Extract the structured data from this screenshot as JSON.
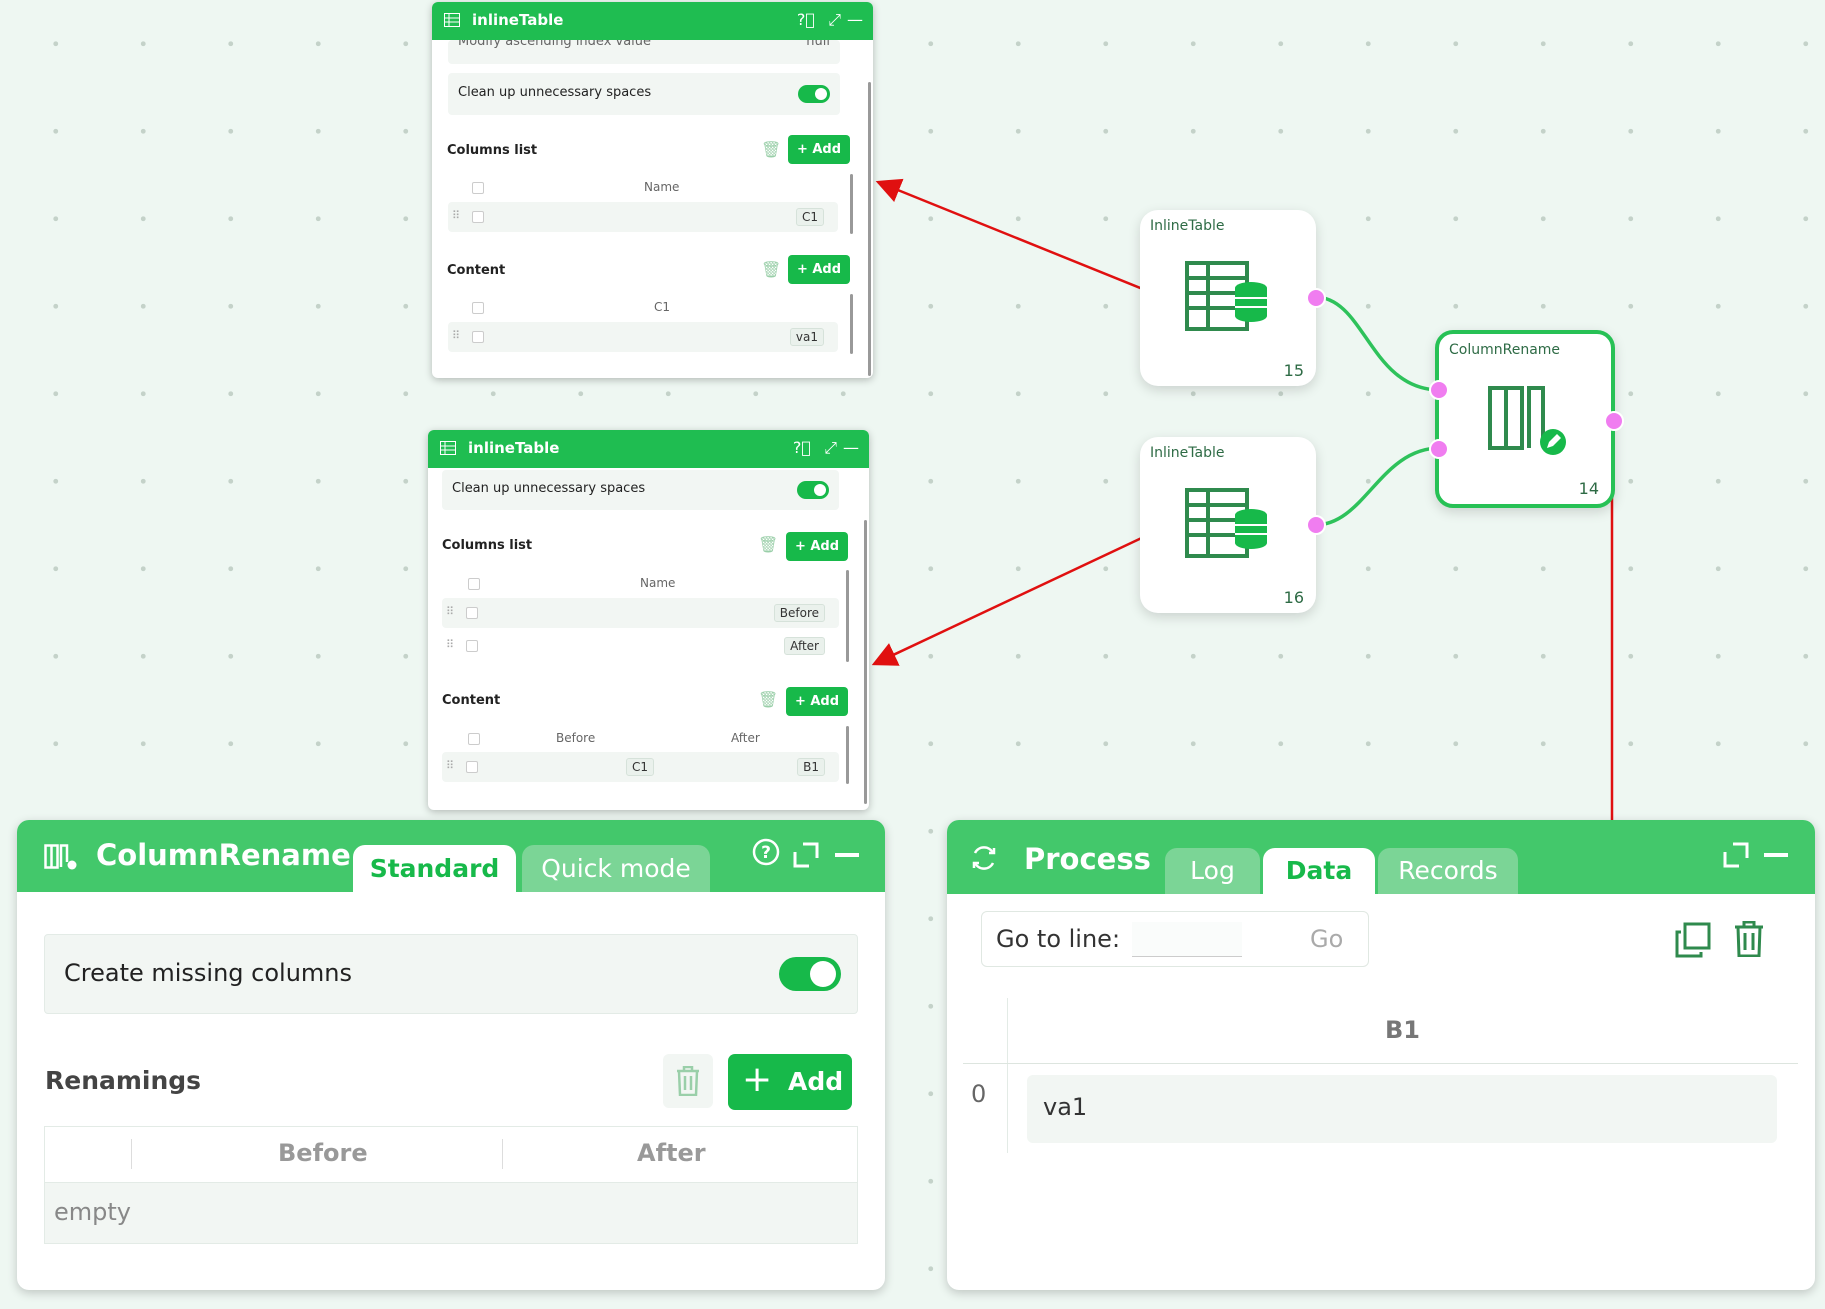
{
  "inline_table_top": {
    "title": "inlineTable",
    "clipped_row_label": "Modify ascending index value",
    "clipped_row_value": "null",
    "cleanup_label": "Clean up unnecessary spaces",
    "columns_list_label": "Columns list",
    "add_label": "Add",
    "name_header": "Name",
    "columns": [
      "C1"
    ],
    "content_label": "Content",
    "content_headers": [
      "C1"
    ],
    "content_rows": [
      [
        "va1"
      ]
    ]
  },
  "inline_table_bottom": {
    "title": "inlineTable",
    "cleanup_label": "Clean up unnecessary spaces",
    "columns_list_label": "Columns list",
    "add_label": "Add",
    "name_header": "Name",
    "columns": [
      "Before",
      "After"
    ],
    "content_label": "Content",
    "content_headers": [
      "Before",
      "After"
    ],
    "content_rows": [
      [
        "C1",
        "B1"
      ]
    ]
  },
  "nodes": {
    "inline_table_1": {
      "title": "InlineTable",
      "number": "15"
    },
    "inline_table_2": {
      "title": "InlineTable",
      "number": "16"
    },
    "column_rename": {
      "title": "ColumnRename",
      "number": "14"
    }
  },
  "column_rename_panel": {
    "title": "ColumnRename",
    "tabs": [
      "Standard",
      "Quick mode"
    ],
    "active_tab": "Standard",
    "create_missing_label": "Create missing columns",
    "create_missing_on": true,
    "renamings_label": "Renamings",
    "add_label": "Add",
    "headers": [
      "Before",
      "After"
    ],
    "empty_text": "empty"
  },
  "process_panel": {
    "title": "Process",
    "tabs": [
      "Log",
      "Data",
      "Records"
    ],
    "active_tab": "Data",
    "goto_label": "Go to line:",
    "goto_button": "Go",
    "column_header": "B1",
    "rows": [
      {
        "index": "0",
        "value": "va1"
      }
    ]
  },
  "colors": {
    "accent": "#17b94a",
    "header": "#43c86b",
    "port": "#f07df0",
    "arrow": "#e01010"
  }
}
